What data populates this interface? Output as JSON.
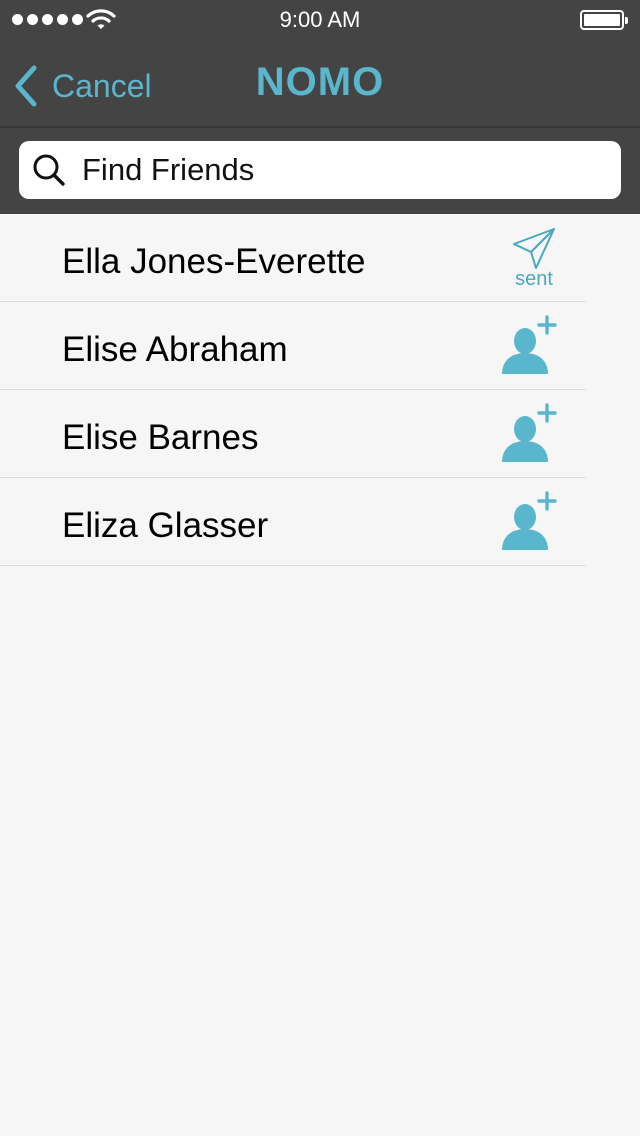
{
  "status_bar": {
    "time": "9:00 AM",
    "signal_icon": "signal-dots-icon",
    "wifi_icon": "wifi-icon",
    "battery_icon": "battery-icon"
  },
  "nav": {
    "back_label": "Cancel",
    "back_icon": "chevron-left-icon",
    "title": "NOMO"
  },
  "search": {
    "placeholder": "Find Friends",
    "value": "",
    "icon": "search-icon"
  },
  "friends": [
    {
      "name": "Ella Jones-Everette",
      "status": "sent",
      "action_label": "sent",
      "icon": "paper-plane-icon"
    },
    {
      "name": "Elise Abraham",
      "status": "add",
      "icon": "add-friend-icon"
    },
    {
      "name": "Elise Barnes",
      "status": "add",
      "icon": "add-friend-icon"
    },
    {
      "name": "Eliza Glasser",
      "status": "add",
      "icon": "add-friend-icon"
    }
  ],
  "colors": {
    "accent": "#5ab6cc",
    "header_bg": "#444444",
    "list_bg": "#f6f6f6"
  }
}
